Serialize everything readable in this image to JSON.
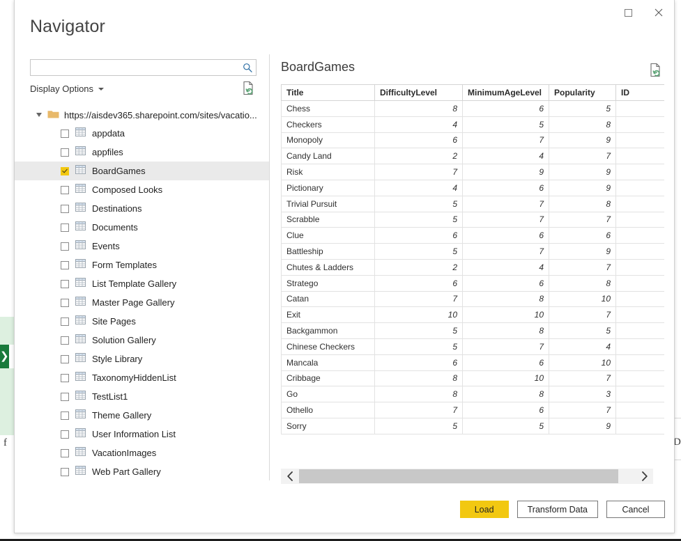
{
  "window": {
    "title": "Navigator",
    "controls": [
      {
        "name": "maximize-button",
        "icon": "maximize-icon",
        "label": "☐"
      },
      {
        "name": "close-button",
        "icon": "close-icon",
        "label": "✕"
      }
    ]
  },
  "search": {
    "value": "",
    "placeholder": "",
    "icon": "search-icon"
  },
  "left_pane": {
    "display_options_label": "Display Options",
    "display_options_icon": "chevron-down-icon",
    "refresh_icon": "refresh-preview-icon",
    "tree": {
      "root": {
        "label": "https://aisdev365.sharepoint.com/sites/vacatio...",
        "expander_icon": "triangle-expanded-icon",
        "folder_icon": "folder-icon",
        "expanded": true
      },
      "items": [
        {
          "label": "appdata",
          "checked": false,
          "selected": false,
          "icon": "table-icon"
        },
        {
          "label": "appfiles",
          "checked": false,
          "selected": false,
          "icon": "table-icon"
        },
        {
          "label": "BoardGames",
          "checked": true,
          "selected": true,
          "icon": "table-icon"
        },
        {
          "label": "Composed Looks",
          "checked": false,
          "selected": false,
          "icon": "table-icon"
        },
        {
          "label": "Destinations",
          "checked": false,
          "selected": false,
          "icon": "table-icon"
        },
        {
          "label": "Documents",
          "checked": false,
          "selected": false,
          "icon": "table-icon"
        },
        {
          "label": "Events",
          "checked": false,
          "selected": false,
          "icon": "table-icon"
        },
        {
          "label": "Form Templates",
          "checked": false,
          "selected": false,
          "icon": "table-icon"
        },
        {
          "label": "List Template Gallery",
          "checked": false,
          "selected": false,
          "icon": "table-icon"
        },
        {
          "label": "Master Page Gallery",
          "checked": false,
          "selected": false,
          "icon": "table-icon"
        },
        {
          "label": "Site Pages",
          "checked": false,
          "selected": false,
          "icon": "table-icon"
        },
        {
          "label": "Solution Gallery",
          "checked": false,
          "selected": false,
          "icon": "table-icon"
        },
        {
          "label": "Style Library",
          "checked": false,
          "selected": false,
          "icon": "table-icon"
        },
        {
          "label": "TaxonomyHiddenList",
          "checked": false,
          "selected": false,
          "icon": "table-icon"
        },
        {
          "label": "TestList1",
          "checked": false,
          "selected": false,
          "icon": "table-icon"
        },
        {
          "label": "Theme Gallery",
          "checked": false,
          "selected": false,
          "icon": "table-icon"
        },
        {
          "label": "User Information List",
          "checked": false,
          "selected": false,
          "icon": "table-icon"
        },
        {
          "label": "VacationImages",
          "checked": false,
          "selected": false,
          "icon": "table-icon"
        },
        {
          "label": "Web Part Gallery",
          "checked": false,
          "selected": false,
          "icon": "table-icon"
        }
      ]
    }
  },
  "preview": {
    "title": "BoardGames",
    "refresh_icon": "refresh-preview-icon",
    "columns": [
      "Title",
      "DifficultyLevel",
      "MinimumAgeLevel",
      "Popularity",
      "ID"
    ],
    "rows": [
      [
        "Chess",
        "8",
        "6",
        "5",
        ""
      ],
      [
        "Checkers",
        "4",
        "5",
        "8",
        ""
      ],
      [
        "Monopoly",
        "6",
        "7",
        "9",
        ""
      ],
      [
        "Candy Land",
        "2",
        "4",
        "7",
        ""
      ],
      [
        "Risk",
        "7",
        "9",
        "9",
        ""
      ],
      [
        "Pictionary",
        "4",
        "6",
        "9",
        ""
      ],
      [
        "Trivial Pursuit",
        "5",
        "7",
        "8",
        ""
      ],
      [
        "Scrabble",
        "5",
        "7",
        "7",
        ""
      ],
      [
        "Clue",
        "6",
        "6",
        "6",
        ""
      ],
      [
        "Battleship",
        "5",
        "7",
        "9",
        ""
      ],
      [
        "Chutes & Ladders",
        "2",
        "4",
        "7",
        ""
      ],
      [
        "Stratego",
        "6",
        "6",
        "8",
        ""
      ],
      [
        "Catan",
        "7",
        "8",
        "10",
        ""
      ],
      [
        "Exit",
        "10",
        "10",
        "7",
        ""
      ],
      [
        "Backgammon",
        "5",
        "8",
        "5",
        ""
      ],
      [
        "Chinese Checkers",
        "5",
        "7",
        "4",
        ""
      ],
      [
        "Mancala",
        "6",
        "6",
        "10",
        ""
      ],
      [
        "Cribbage",
        "8",
        "10",
        "7",
        ""
      ],
      [
        "Go",
        "8",
        "8",
        "3",
        ""
      ],
      [
        "Othello",
        "7",
        "6",
        "7",
        ""
      ],
      [
        "Sorry",
        "5",
        "5",
        "9",
        ""
      ]
    ],
    "scroll": {
      "left_arrow_icon": "chevron-left-icon",
      "right_arrow_icon": "chevron-right-icon"
    }
  },
  "footer": {
    "buttons": [
      {
        "name": "load-button",
        "label": "Load",
        "primary": true
      },
      {
        "name": "transform-data-button",
        "label": "Transform Data",
        "primary": false
      },
      {
        "name": "cancel-button",
        "label": "Cancel",
        "primary": false
      }
    ]
  },
  "colors": {
    "accent": "#f2c811",
    "selection": "#eaeaea",
    "folder": "#e8b96a",
    "grid_line": "#e2e2e2",
    "header_line": "#d4d4d4",
    "refresh_green": "#5aa374"
  }
}
